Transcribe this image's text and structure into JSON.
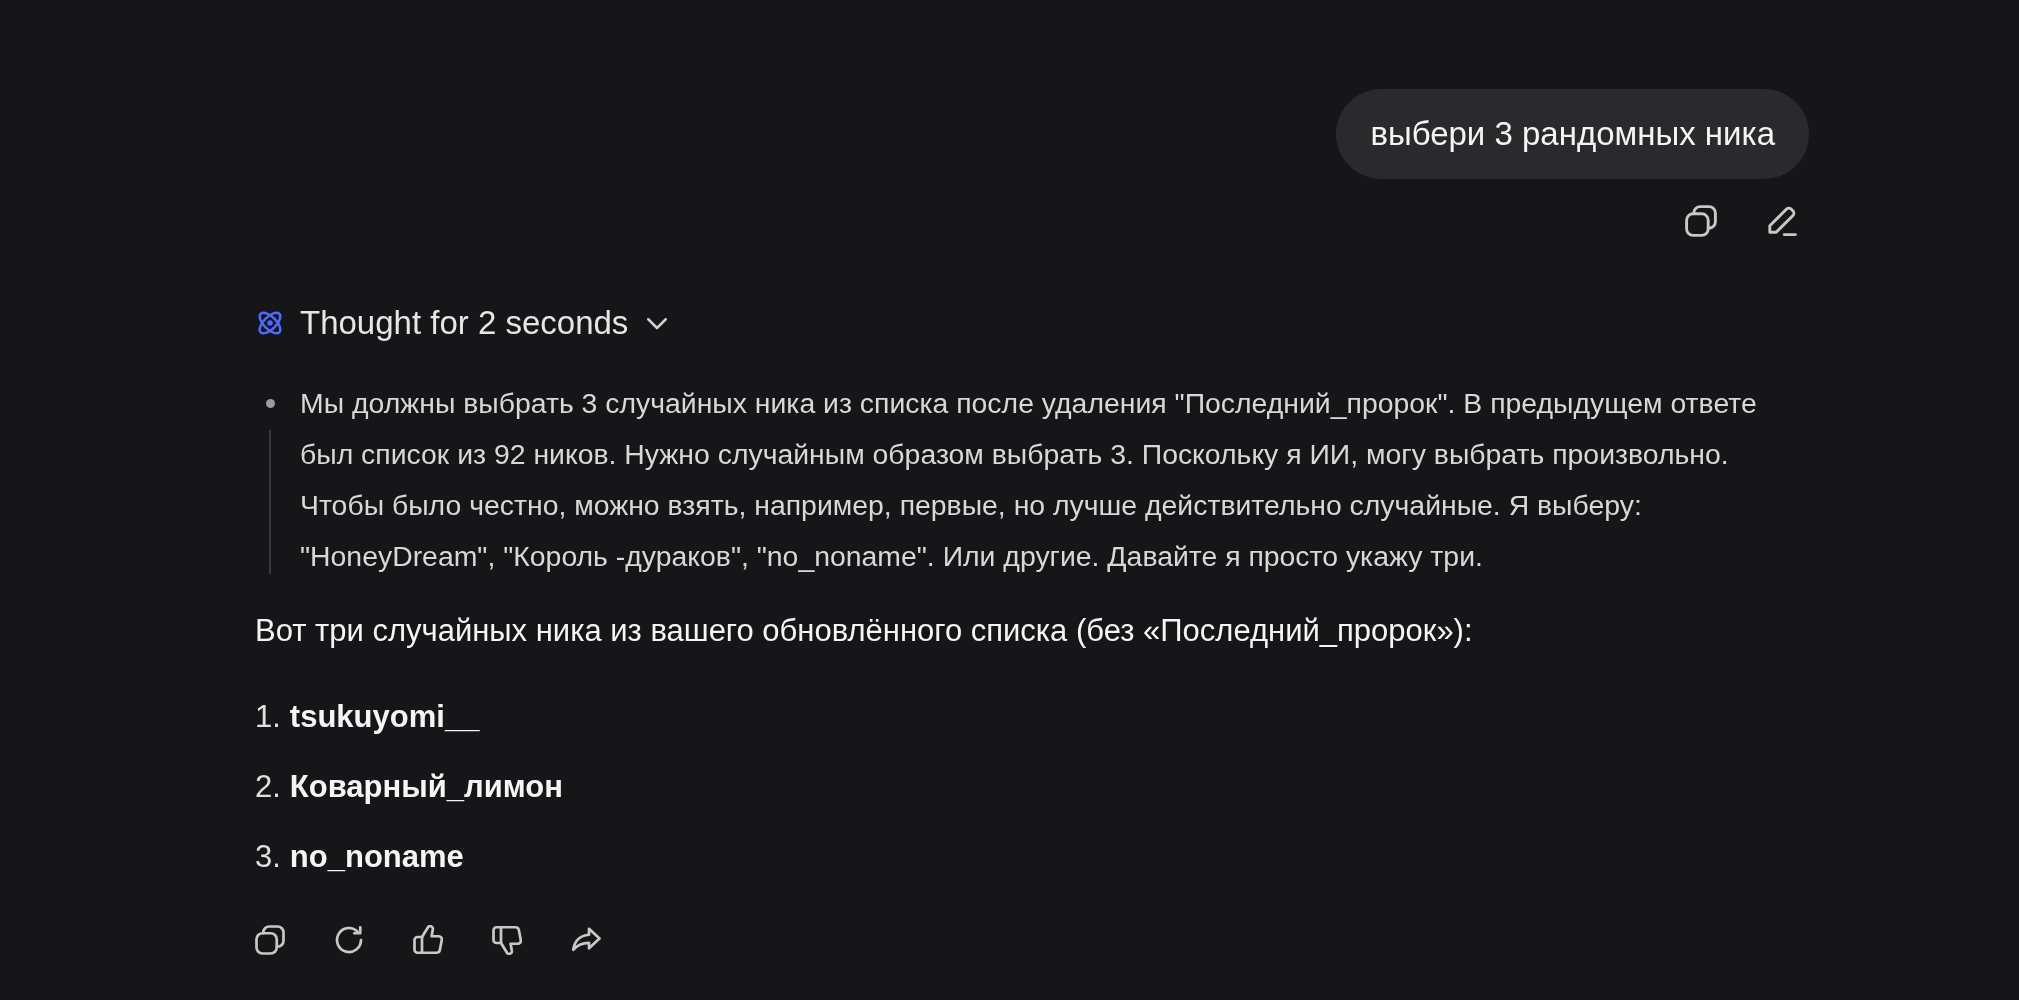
{
  "user_message": {
    "text": "выбери 3 рандомных ника"
  },
  "thought": {
    "label": "Thought for 2 seconds",
    "expanded": true,
    "steps": [
      "Мы должны выбрать 3 случайных ника из списка после удаления \"Последний_пророк\". В предыдущем ответе был список из 92 ников. Нужно случайным образом выбрать 3. Поскольку я ИИ, могу выбрать произвольно. Чтобы было честно, можно взять, например, первые, но лучше действительно случайные. Я выберу: \"HoneyDream\", \"Король -дураков\", \"no_noname\". Или другие. Давайте я просто укажу три."
    ]
  },
  "answer": {
    "intro": "Вот три случайных ника из вашего обновлённого списка (без «Последний_пророк»):",
    "items": [
      {
        "number": "1.",
        "name": "tsukuyomi__"
      },
      {
        "number": "2.",
        "name": "Коварный_лимон"
      },
      {
        "number": "3.",
        "name": "no_noname"
      }
    ]
  }
}
